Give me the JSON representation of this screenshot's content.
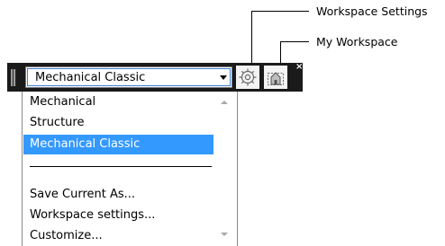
{
  "callouts": {
    "workspace_settings": "Workspace Settings",
    "my_workspace": "My Workspace"
  },
  "toolbar": {
    "close_glyph": "×",
    "current_workspace": "Mechanical Classic",
    "settings_icon": "gear-icon",
    "my_workspace_icon": "home-icon"
  },
  "dropdown": {
    "workspaces": [
      {
        "label": "Mechanical",
        "selected": false
      },
      {
        "label": "Structure",
        "selected": false
      },
      {
        "label": "Mechanical Classic",
        "selected": true
      }
    ],
    "actions": [
      {
        "label": "Save Current As..."
      },
      {
        "label": "Workspace settings..."
      },
      {
        "label": "Customize..."
      }
    ]
  },
  "colors": {
    "toolbar_bg": "#1a1a1a",
    "selection": "#3399ff",
    "combo_focus": "#3c7fd6"
  }
}
